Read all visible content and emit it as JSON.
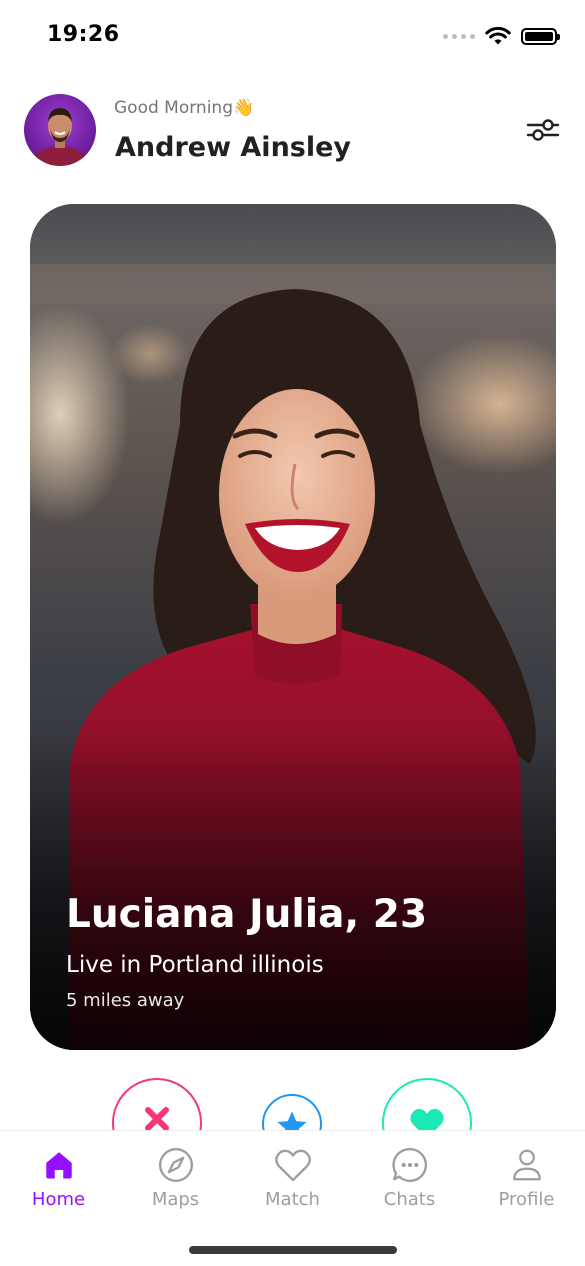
{
  "status_bar": {
    "time": "19:26"
  },
  "header": {
    "greeting": "Good Morning👋",
    "user_name": "Andrew Ainsley"
  },
  "card": {
    "name_age": "Luciana Julia, 23",
    "location": "Live in Portland illinois",
    "distance": "5 miles away"
  },
  "actions": {
    "dislike_icon": "close-icon",
    "superlike_icon": "star-icon",
    "like_icon": "heart-icon"
  },
  "bottom_nav": {
    "items": [
      {
        "label": "Home",
        "icon": "home-icon",
        "active": true
      },
      {
        "label": "Maps",
        "icon": "compass-icon",
        "active": false
      },
      {
        "label": "Match",
        "icon": "heart-outline-icon",
        "active": false
      },
      {
        "label": "Chats",
        "icon": "chat-icon",
        "active": false
      },
      {
        "label": "Profile",
        "icon": "person-icon",
        "active": false
      }
    ]
  },
  "colors": {
    "primary": "#9610ff",
    "dislike": "#f7357a",
    "superlike": "#2196f3",
    "like": "#1de9b6",
    "text_dark": "#212121",
    "text_muted": "#9e9e9e"
  }
}
